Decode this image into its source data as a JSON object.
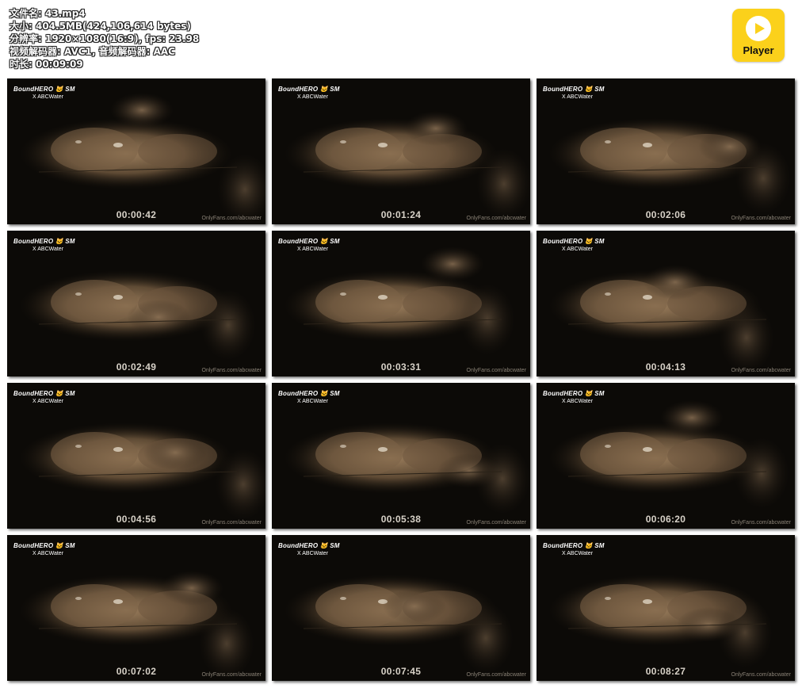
{
  "meta": {
    "filename": "文件名: 43.mp4",
    "size": "大小: 404.5MB(424,106,614 bytes)",
    "resolution": "分辨率: 1920×1080(16:9), fps: 23.98",
    "codec": "视频解码器: AVC1, 音频解码器: AAC",
    "duration": "时长: 00:09:09"
  },
  "player_badge": {
    "label": "Player",
    "icon": "play-circle-icon",
    "color": "#fbd11b"
  },
  "brand_line1": "BoundHERO 🐱 SM",
  "brand_line2": "X ABCWater",
  "watermark": "OnlyFans.com/abcwater",
  "thumbnails": [
    {
      "timestamp": "00:00:42"
    },
    {
      "timestamp": "00:01:24"
    },
    {
      "timestamp": "00:02:06"
    },
    {
      "timestamp": "00:02:49"
    },
    {
      "timestamp": "00:03:31"
    },
    {
      "timestamp": "00:04:13"
    },
    {
      "timestamp": "00:04:56"
    },
    {
      "timestamp": "00:05:38"
    },
    {
      "timestamp": "00:06:20"
    },
    {
      "timestamp": "00:07:02"
    },
    {
      "timestamp": "00:07:45"
    },
    {
      "timestamp": "00:08:27"
    }
  ]
}
